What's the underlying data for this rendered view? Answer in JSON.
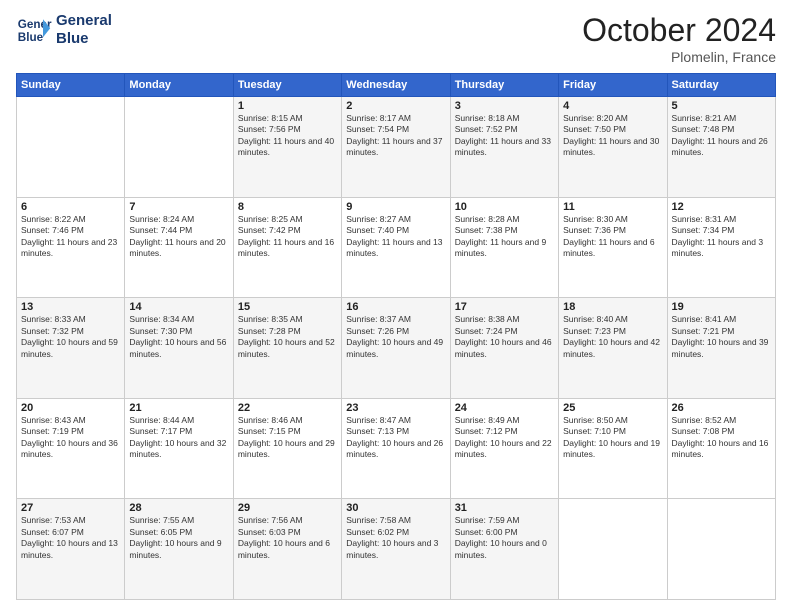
{
  "header": {
    "logo_line1": "General",
    "logo_line2": "Blue",
    "month": "October 2024",
    "location": "Plomelin, France"
  },
  "weekdays": [
    "Sunday",
    "Monday",
    "Tuesday",
    "Wednesday",
    "Thursday",
    "Friday",
    "Saturday"
  ],
  "weeks": [
    [
      {
        "day": "",
        "text": ""
      },
      {
        "day": "",
        "text": ""
      },
      {
        "day": "1",
        "text": "Sunrise: 8:15 AM\nSunset: 7:56 PM\nDaylight: 11 hours and 40 minutes."
      },
      {
        "day": "2",
        "text": "Sunrise: 8:17 AM\nSunset: 7:54 PM\nDaylight: 11 hours and 37 minutes."
      },
      {
        "day": "3",
        "text": "Sunrise: 8:18 AM\nSunset: 7:52 PM\nDaylight: 11 hours and 33 minutes."
      },
      {
        "day": "4",
        "text": "Sunrise: 8:20 AM\nSunset: 7:50 PM\nDaylight: 11 hours and 30 minutes."
      },
      {
        "day": "5",
        "text": "Sunrise: 8:21 AM\nSunset: 7:48 PM\nDaylight: 11 hours and 26 minutes."
      }
    ],
    [
      {
        "day": "6",
        "text": "Sunrise: 8:22 AM\nSunset: 7:46 PM\nDaylight: 11 hours and 23 minutes."
      },
      {
        "day": "7",
        "text": "Sunrise: 8:24 AM\nSunset: 7:44 PM\nDaylight: 11 hours and 20 minutes."
      },
      {
        "day": "8",
        "text": "Sunrise: 8:25 AM\nSunset: 7:42 PM\nDaylight: 11 hours and 16 minutes."
      },
      {
        "day": "9",
        "text": "Sunrise: 8:27 AM\nSunset: 7:40 PM\nDaylight: 11 hours and 13 minutes."
      },
      {
        "day": "10",
        "text": "Sunrise: 8:28 AM\nSunset: 7:38 PM\nDaylight: 11 hours and 9 minutes."
      },
      {
        "day": "11",
        "text": "Sunrise: 8:30 AM\nSunset: 7:36 PM\nDaylight: 11 hours and 6 minutes."
      },
      {
        "day": "12",
        "text": "Sunrise: 8:31 AM\nSunset: 7:34 PM\nDaylight: 11 hours and 3 minutes."
      }
    ],
    [
      {
        "day": "13",
        "text": "Sunrise: 8:33 AM\nSunset: 7:32 PM\nDaylight: 10 hours and 59 minutes."
      },
      {
        "day": "14",
        "text": "Sunrise: 8:34 AM\nSunset: 7:30 PM\nDaylight: 10 hours and 56 minutes."
      },
      {
        "day": "15",
        "text": "Sunrise: 8:35 AM\nSunset: 7:28 PM\nDaylight: 10 hours and 52 minutes."
      },
      {
        "day": "16",
        "text": "Sunrise: 8:37 AM\nSunset: 7:26 PM\nDaylight: 10 hours and 49 minutes."
      },
      {
        "day": "17",
        "text": "Sunrise: 8:38 AM\nSunset: 7:24 PM\nDaylight: 10 hours and 46 minutes."
      },
      {
        "day": "18",
        "text": "Sunrise: 8:40 AM\nSunset: 7:23 PM\nDaylight: 10 hours and 42 minutes."
      },
      {
        "day": "19",
        "text": "Sunrise: 8:41 AM\nSunset: 7:21 PM\nDaylight: 10 hours and 39 minutes."
      }
    ],
    [
      {
        "day": "20",
        "text": "Sunrise: 8:43 AM\nSunset: 7:19 PM\nDaylight: 10 hours and 36 minutes."
      },
      {
        "day": "21",
        "text": "Sunrise: 8:44 AM\nSunset: 7:17 PM\nDaylight: 10 hours and 32 minutes."
      },
      {
        "day": "22",
        "text": "Sunrise: 8:46 AM\nSunset: 7:15 PM\nDaylight: 10 hours and 29 minutes."
      },
      {
        "day": "23",
        "text": "Sunrise: 8:47 AM\nSunset: 7:13 PM\nDaylight: 10 hours and 26 minutes."
      },
      {
        "day": "24",
        "text": "Sunrise: 8:49 AM\nSunset: 7:12 PM\nDaylight: 10 hours and 22 minutes."
      },
      {
        "day": "25",
        "text": "Sunrise: 8:50 AM\nSunset: 7:10 PM\nDaylight: 10 hours and 19 minutes."
      },
      {
        "day": "26",
        "text": "Sunrise: 8:52 AM\nSunset: 7:08 PM\nDaylight: 10 hours and 16 minutes."
      }
    ],
    [
      {
        "day": "27",
        "text": "Sunrise: 7:53 AM\nSunset: 6:07 PM\nDaylight: 10 hours and 13 minutes."
      },
      {
        "day": "28",
        "text": "Sunrise: 7:55 AM\nSunset: 6:05 PM\nDaylight: 10 hours and 9 minutes."
      },
      {
        "day": "29",
        "text": "Sunrise: 7:56 AM\nSunset: 6:03 PM\nDaylight: 10 hours and 6 minutes."
      },
      {
        "day": "30",
        "text": "Sunrise: 7:58 AM\nSunset: 6:02 PM\nDaylight: 10 hours and 3 minutes."
      },
      {
        "day": "31",
        "text": "Sunrise: 7:59 AM\nSunset: 6:00 PM\nDaylight: 10 hours and 0 minutes."
      },
      {
        "day": "",
        "text": ""
      },
      {
        "day": "",
        "text": ""
      }
    ]
  ]
}
